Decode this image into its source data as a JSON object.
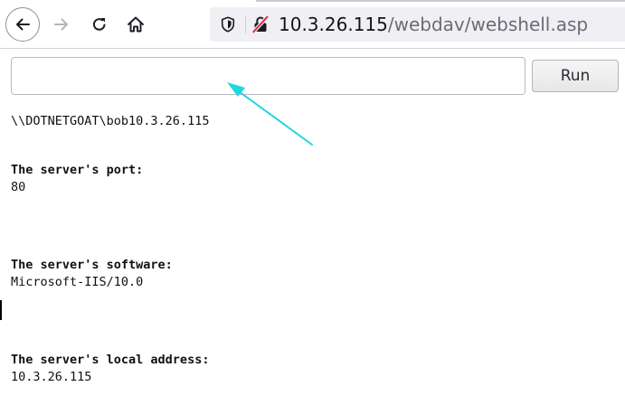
{
  "browser": {
    "url_host": "10.3.26.115",
    "url_path": "/webdav/webshell.asp"
  },
  "form": {
    "command_value": "",
    "run_label": "Run"
  },
  "output": {
    "identity": "\\\\DOTNETGOAT\\bob10.3.26.115",
    "port_label": "The server's port:",
    "port_value": "80",
    "software_label": "The server's software:",
    "software_value": "Microsoft-IIS/10.0",
    "local_address_label": "The server's local address:",
    "local_address_value": "10.3.26.115"
  },
  "colors": {
    "annotation_arrow": "#1fd6e0"
  },
  "icons": {
    "back": "arrow-left-icon",
    "forward": "arrow-right-icon",
    "reload": "reload-icon",
    "home": "home-icon",
    "tracking": "shield-icon",
    "connection": "insecure-lock-icon",
    "annotation": "arrow-annotation-icon"
  }
}
